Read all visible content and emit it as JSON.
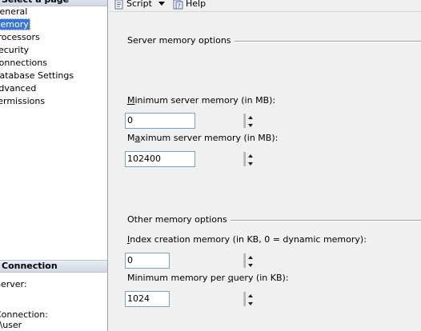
{
  "left": {
    "select_page_header": "Select a page",
    "pages": [
      {
        "label": "General"
      },
      {
        "label": "Memory"
      },
      {
        "label": "Processors"
      },
      {
        "label": "Security"
      },
      {
        "label": "Connections"
      },
      {
        "label": "Database Settings"
      },
      {
        "label": "Advanced"
      },
      {
        "label": "Permissions"
      }
    ],
    "connection_header": "Connection",
    "connection_lines": [
      "Server:",
      "",
      "Connection:",
      "_\\user"
    ]
  },
  "toolbar": {
    "script_label": "Script",
    "help_label": "Help"
  },
  "server_memory": {
    "group_title": "Server memory options",
    "min_label_accel": "M",
    "min_label_rest": "inimum server memory (in MB):",
    "min_value": "0",
    "max_label_pre": "M",
    "max_label_accel": "a",
    "max_label_rest": "ximum server memory (in MB):",
    "max_value": "102400"
  },
  "other_memory": {
    "group_title": "Other memory options",
    "index_label_accel": "I",
    "index_label_rest": "ndex creation memory (in KB, 0 = dynamic memory):",
    "index_value": "0",
    "minq_label_pre": "Minimum memory per ",
    "minq_label_accel": "q",
    "minq_label_rest": "uery (in KB):",
    "minq_value": "1024"
  },
  "colors": {
    "selection": "#3875d7",
    "header": "#cfd8e4"
  }
}
